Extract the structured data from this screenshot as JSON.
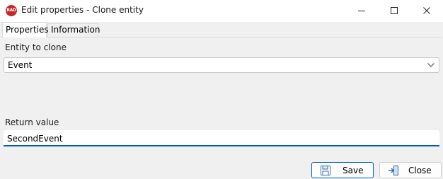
{
  "window": {
    "app_icon_text": "RAD",
    "title": "Edit properties - Clone entity"
  },
  "tabs": [
    {
      "label": "Properties",
      "active": true
    },
    {
      "label": "Information",
      "active": false
    }
  ],
  "form": {
    "entity_label": "Entity to clone",
    "entity_value": "Event",
    "return_label": "Return value",
    "return_value": "SecondEvent"
  },
  "buttons": {
    "save_label": "Save",
    "close_label": "Close"
  },
  "colors": {
    "accent": "#005fb8",
    "app_icon": "#c62828"
  },
  "icons": {
    "minimize": "minimize-icon",
    "maximize": "maximize-icon",
    "close": "close-icon",
    "combo_arrow": "chevron-down-icon",
    "save": "floppy-disk-icon",
    "close_dialog": "exit-door-icon"
  }
}
